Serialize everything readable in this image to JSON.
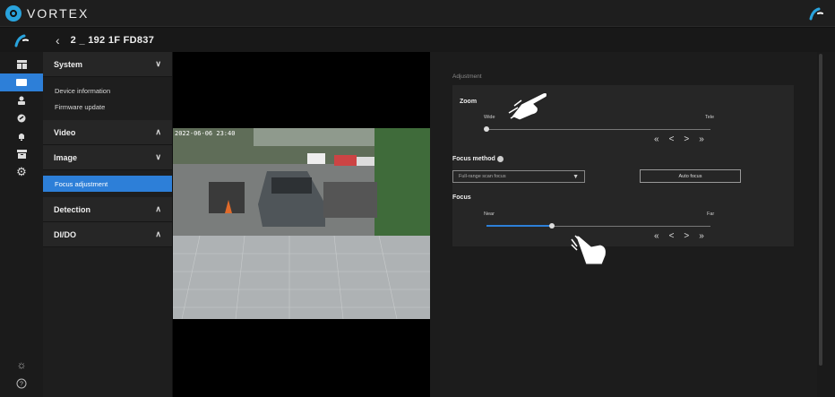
{
  "app": {
    "brand": "VORTEX"
  },
  "device": {
    "back_icon": "chevron-left-icon",
    "name": "2 _ 192 1F FD837"
  },
  "rail": {
    "items": [
      {
        "icon": "dashboard-icon"
      },
      {
        "icon": "camera-icon",
        "active": true
      },
      {
        "icon": "user-icon"
      },
      {
        "icon": "tag-icon"
      },
      {
        "icon": "bell-icon"
      },
      {
        "icon": "archive-icon"
      },
      {
        "icon": "gear-icon"
      }
    ],
    "bottom": [
      {
        "icon": "sun-icon"
      },
      {
        "icon": "help-icon"
      }
    ]
  },
  "menu": {
    "system": {
      "label": "System",
      "chevron": "∨"
    },
    "system_items": [
      "Device information",
      "Firmware update"
    ],
    "video": {
      "label": "Video",
      "chevron": "∧"
    },
    "image": {
      "label": "Image",
      "chevron": "∨"
    },
    "image_items": [
      "Focus adjustment"
    ],
    "detection": {
      "label": "Detection",
      "chevron": "∧"
    },
    "dido": {
      "label": "DI/DO",
      "chevron": "∧"
    }
  },
  "video": {
    "osd": "2022-06-06 23:40"
  },
  "adjustment": {
    "title": "Adjustment",
    "zoom": {
      "label": "Zoom",
      "min_label": "Wide",
      "max_label": "Tele",
      "value": 0.0
    },
    "focus_method": {
      "label": "Focus method",
      "selected": "Full-range scan focus",
      "auto_button": "Auto focus"
    },
    "focus": {
      "label": "Focus",
      "min_label": "Near",
      "max_label": "Far",
      "value": 0.29
    },
    "nav": [
      "«",
      "<",
      ">",
      "»"
    ]
  },
  "colors": {
    "accent": "#2d7fd8",
    "brand": "#29a3dd"
  }
}
